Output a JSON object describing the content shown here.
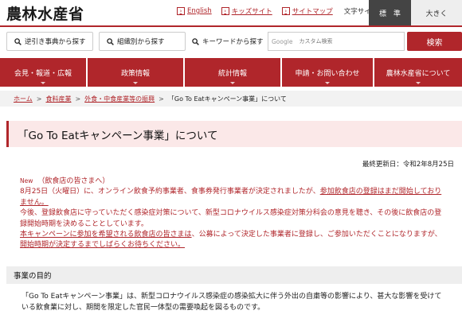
{
  "header": {
    "logo": "農林水産省",
    "links": [
      {
        "label": "English"
      },
      {
        "label": "キッズサイト"
      },
      {
        "label": "サイトマップ"
      }
    ],
    "text_size_label": "文字サイズ",
    "size_standard": "標　準",
    "size_large": "大きく"
  },
  "search": {
    "reverse_lookup": "逆引き事典から探す",
    "by_org": "組織別から探す",
    "keyword_label": "キーワードから探す",
    "engine_label": "Google",
    "placeholder": "カスタム検索",
    "button": "検索"
  },
  "nav": {
    "items": [
      {
        "label": "会見・報道・広報"
      },
      {
        "label": "政策情報"
      },
      {
        "label": "統計情報"
      },
      {
        "label": "申請・お問い合わせ"
      },
      {
        "label": "農林水産省について"
      }
    ]
  },
  "breadcrumb": {
    "items": [
      {
        "label": "ホーム"
      },
      {
        "label": "食料産業"
      },
      {
        "label": "外食・中食産業等の振興"
      }
    ],
    "separator": ">",
    "current": "「Go To Eatキャンペーン事業」について"
  },
  "page": {
    "title": "「Go To Eatキャンペーン事業」について",
    "updated": "最終更新日：令和2年8月25日"
  },
  "news": {
    "new_tag": "New",
    "audience": "（飲食店の皆さまへ）",
    "line1_pre": "8月25日（火曜日）に、オンライン飲食予約事業者、食事券発行事業者が決定されましたが、",
    "line1_link": "参加飲食店の登録はまだ開始しておりません。",
    "line2": "今後、登録飲食店に守っていただく感染症対策について、新型コロナウイルス感染症対策分科会の意見を聴き、その後に飲食店の登録開始時期を決めることとしています。",
    "line3_link1": "本キャンペーンに参加を希望される飲食店の皆さまは",
    "line3_mid": "、公募によって決定した事業者に登録し、ご参加いただくことになりますが、",
    "line3_link2": "開始時期が決定するまでしばらくお待ちください。"
  },
  "section": {
    "heading": "事業の目的",
    "body": "「Go To Eatキャンペーン事業」は、新型コロナウイルス感染症の感染拡大に伴う外出の自粛等の影響により、甚大な影響を受けている飲食業に対し、期間を限定した官民一体型の需要喚起を図るものです。"
  },
  "colors": {
    "accent": "#b0262b",
    "title_bg": "#fbe8e8",
    "crumb_bg": "#f2f2f2"
  }
}
